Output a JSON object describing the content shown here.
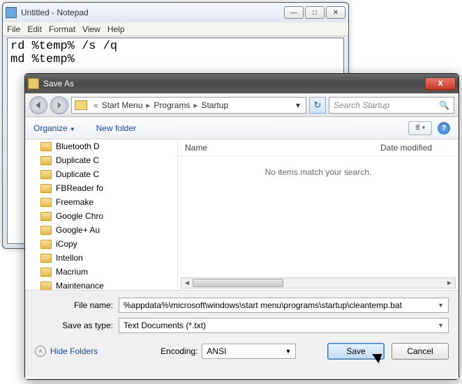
{
  "notepad": {
    "title": "Untitled - Notepad",
    "menu": [
      "File",
      "Edit",
      "Format",
      "View",
      "Help"
    ],
    "content": "rd %temp% /s /q\nmd %temp%"
  },
  "saveas": {
    "title": "Save As",
    "breadcrumb": [
      "Start Menu",
      "Programs",
      "Startup"
    ],
    "search_placeholder": "Search Startup",
    "toolbar": {
      "organize": "Organize",
      "newfolder": "New folder"
    },
    "tree_items": [
      "Bluetooth D",
      "Duplicate C",
      "Duplicate C",
      "FBReader fo",
      "Freemake",
      "Google Chro",
      "Google+ Au",
      "iCopy",
      "Intellon",
      "Macrium",
      "Maintenance"
    ],
    "list": {
      "col_name": "Name",
      "col_date": "Date modified",
      "empty": "No items match your search."
    },
    "filename_label": "File name:",
    "filename_value": "%appdata%\\microsoft\\windows\\start menu\\programs\\startup\\cleantemp.bat",
    "savetype_label": "Save as type:",
    "savetype_value": "Text Documents (*.txt)",
    "hidefolders": "Hide Folders",
    "encoding_label": "Encoding:",
    "encoding_value": "ANSI",
    "save_btn": "Save",
    "cancel_btn": "Cancel"
  }
}
